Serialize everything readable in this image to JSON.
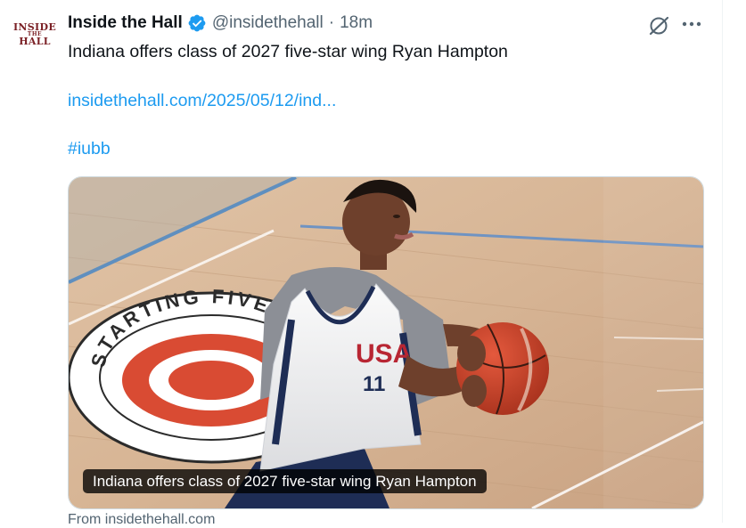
{
  "author": {
    "avatar_lines": [
      "INSIDE",
      "THE",
      "HALL"
    ],
    "name": "Inside the Hall",
    "handle": "@insidethehall",
    "separator": "·",
    "time": "18m",
    "verified": true
  },
  "tweet": {
    "text": "Indiana offers class of 2027 five-star wing Ryan Hampton",
    "link": "insidethehall.com/2025/05/12/ind...",
    "hashtag": "#iubb"
  },
  "media": {
    "caption": "Indiana offers class of 2027 five-star wing Ryan Hampton",
    "court_text": "STARTING FIVE",
    "jersey_text": "USA",
    "jersey_number": "11"
  },
  "card_source": "From insidethehall.com",
  "icons": {
    "verified": "verified-badge-icon",
    "grok": "grok-icon",
    "more": "more-options-icon"
  },
  "colors": {
    "accent": "#1d9bf0",
    "text": "#0f1419",
    "secondary": "#536471",
    "avatar_brand": "#7a1f24"
  }
}
